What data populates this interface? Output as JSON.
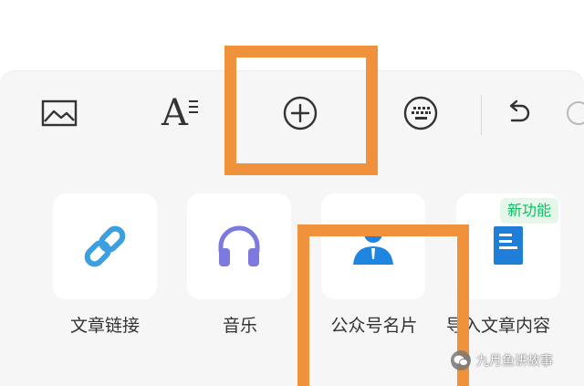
{
  "toolbar": {
    "icons": [
      "image-icon",
      "text-format-icon",
      "add-circle-icon",
      "keyboard-icon",
      "undo-icon"
    ],
    "text_format_glyph": "A"
  },
  "features": {
    "items": [
      {
        "label": "文章链接",
        "icon": "link-icon",
        "color": "#3b9fe0"
      },
      {
        "label": "音乐",
        "icon": "headphones-icon",
        "color": "#7d79de"
      },
      {
        "label": "公众号名片",
        "icon": "person-card-icon",
        "color": "#1e86e0"
      },
      {
        "label": "导入文章内容",
        "icon": "document-icon",
        "color": "#1f7fd8"
      }
    ],
    "badge": "新功能"
  },
  "watermark": {
    "text": "九月鱼讲故事"
  },
  "colors": {
    "highlight": "#f0913c",
    "badge_text": "#07c160",
    "badge_bg": "#e6f7ea",
    "panel_bg": "#f6f6f6"
  }
}
